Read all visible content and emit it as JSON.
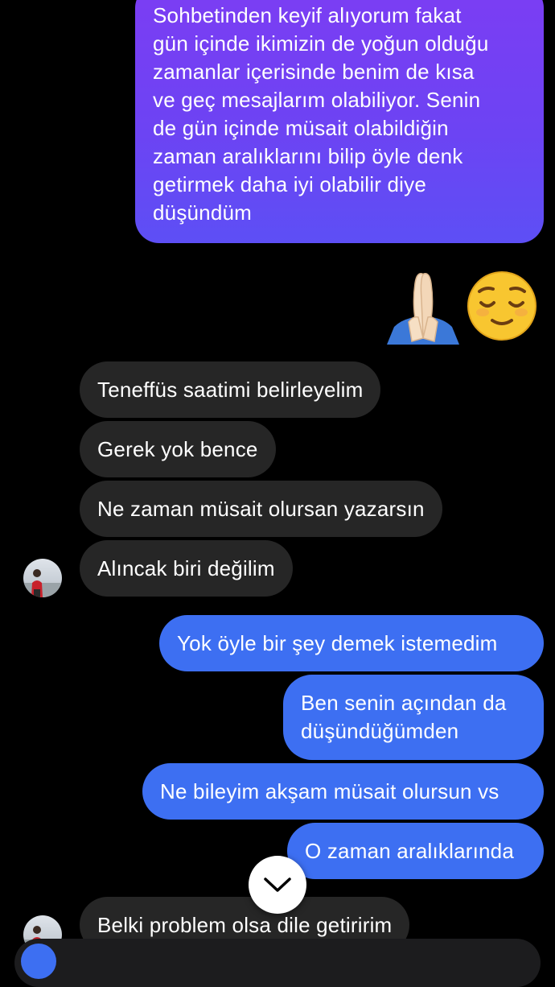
{
  "conversation": {
    "messages": [
      {
        "from": "me",
        "text": "Sohbetinden keyif alıyorum fakat\ngün içinde ikimizin de yoğun olduğu\nzamanlar içerisinde benim de kısa\nve geç mesajlarım olabiliyor. Senin\nde gün içinde müsait olabildiğin\nzaman aralıklarını bilip öyle denk\ngetirmek daha iyi olabilir diye\ndüşündüm"
      },
      {
        "from": "me",
        "text": "🙏🏻😌"
      },
      {
        "from": "them",
        "text": "Teneffüs saatimi belirleyelim"
      },
      {
        "from": "them",
        "text": "Gerek yok bence"
      },
      {
        "from": "them",
        "text": "Ne zaman müsait olursan yazarsın"
      },
      {
        "from": "them",
        "text": "Alıncak biri değilim"
      },
      {
        "from": "me",
        "text": "Yok öyle bir şey demek istemedim"
      },
      {
        "from": "me",
        "text": "Ben senin açından da\ndüşündüğümden"
      },
      {
        "from": "me",
        "text": "Ne bileyim akşam müsait olursun vs"
      },
      {
        "from": "me",
        "text": "O zaman aralıklarında"
      },
      {
        "from": "them",
        "text": "Belki problem olsa dile getiririm"
      }
    ]
  },
  "colors": {
    "background": "#000000",
    "incoming_bubble": "#262626",
    "outgoing_bubble_blue": "#3d6ff2",
    "outgoing_bubble_purple": "#7c3df3"
  },
  "icons": {
    "scroll_down": "chevron-down-icon",
    "avatar": "contact-avatar"
  }
}
